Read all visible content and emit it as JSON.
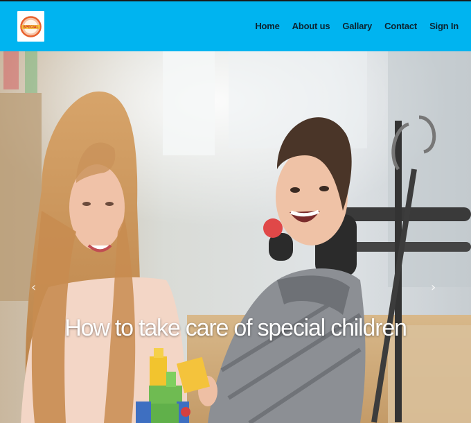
{
  "header": {
    "logo_text": "SPECIAL",
    "nav": [
      {
        "label": "Home"
      },
      {
        "label": "About us"
      },
      {
        "label": "Gallary"
      },
      {
        "label": "Contact"
      },
      {
        "label": "Sign In"
      }
    ]
  },
  "hero": {
    "caption": "How to take care of special children",
    "prev_glyph": "‹",
    "next_glyph": "›"
  },
  "colors": {
    "navbar": "#00b4f0",
    "nav_text": "#0b2431",
    "caption": "#ffffff"
  }
}
